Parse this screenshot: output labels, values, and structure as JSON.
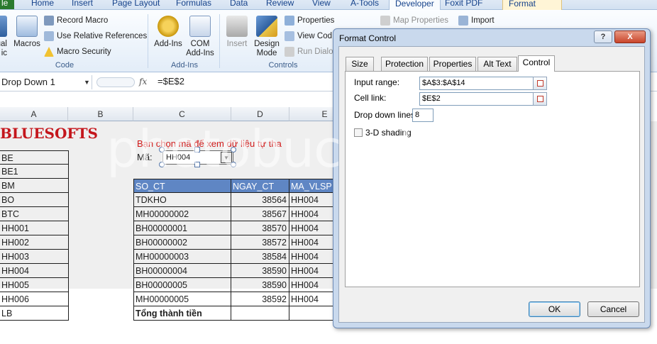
{
  "ribbon_tabs": {
    "file": "le",
    "home": "Home",
    "insert": "Insert",
    "page_layout": "Page Layout",
    "formulas": "Formulas",
    "data": "Data",
    "review": "Review",
    "view": "View",
    "developer": "Developer",
    "atools": "A-Tools",
    "foxit": "Foxit PDF",
    "format": "Format"
  },
  "ribbon": {
    "code": {
      "visual_basic_partial": "ual\nic",
      "macros": "Macros",
      "record_macro": "Record Macro",
      "use_relative": "Use Relative References",
      "macro_security": "Macro Security",
      "label": "Code"
    },
    "addins": {
      "addins": "Add-Ins",
      "com_addins": "COM\nAdd-Ins",
      "label": "Add-Ins"
    },
    "controls": {
      "insert": "Insert",
      "design_mode": "Design\nMode",
      "properties": "Properties",
      "view_code": "View Cod",
      "run_dialog": "Run Dialo",
      "label": "Controls"
    },
    "xml": {
      "map_properties": "Map Properties",
      "import": "Import"
    }
  },
  "formula_bar": {
    "name_box": "Drop Down 1",
    "fx": "fx",
    "formula": "=$E$2"
  },
  "columns": {
    "A": "A",
    "B": "B",
    "C": "C",
    "D": "D",
    "E": "E"
  },
  "logo_text": "BLUESOFTS",
  "instruction": "Bạn chọn mã để xem dữ liệu tự tha",
  "ma_label": "Mã:",
  "dropdown_value": "HH004",
  "col_a_values": [
    "BE",
    "BE1",
    "BM",
    "BO",
    "BTC",
    "HH001",
    "HH002",
    "HH003",
    "HH004",
    "HH005",
    "HH006",
    "LB"
  ],
  "table": {
    "headers": {
      "so_ct": "SO_CT",
      "ngay_ct": "NGAY_CT",
      "ma_vlsp": "MA_VLSP"
    },
    "rows": [
      {
        "so_ct": "TDKHO",
        "ngay_ct": "38564",
        "ma": "HH004"
      },
      {
        "so_ct": "MH00000002",
        "ngay_ct": "38567",
        "ma": "HH004"
      },
      {
        "so_ct": "BH00000001",
        "ngay_ct": "38570",
        "ma": "HH004"
      },
      {
        "so_ct": "BH00000002",
        "ngay_ct": "38572",
        "ma": "HH004"
      },
      {
        "so_ct": "MH00000003",
        "ngay_ct": "38584",
        "ma": "HH004"
      },
      {
        "so_ct": "BH00000004",
        "ngay_ct": "38590",
        "ma": "HH004"
      },
      {
        "so_ct": "BH00000005",
        "ngay_ct": "38590",
        "ma": "HH004"
      },
      {
        "so_ct": "MH00000005",
        "ngay_ct": "38592",
        "ma": "HH004"
      }
    ],
    "total_label": "Tổng thành tiền"
  },
  "dialog": {
    "title": "Format Control",
    "help": "?",
    "close": "X",
    "tabs": {
      "size": "Size",
      "protection": "Protection",
      "properties": "Properties",
      "alt_text": "Alt Text",
      "control": "Control"
    },
    "input_range_label": "Input range:",
    "input_range_value": "$A$3:$A$14",
    "cell_link_label": "Cell link:",
    "cell_link_value": "$E$2",
    "drop_down_lines_label": "Drop down lines:",
    "drop_down_lines_value": "8",
    "shading_label": "3-D shading",
    "ok": "OK",
    "cancel": "Cancel"
  },
  "watermark": "photobucket"
}
